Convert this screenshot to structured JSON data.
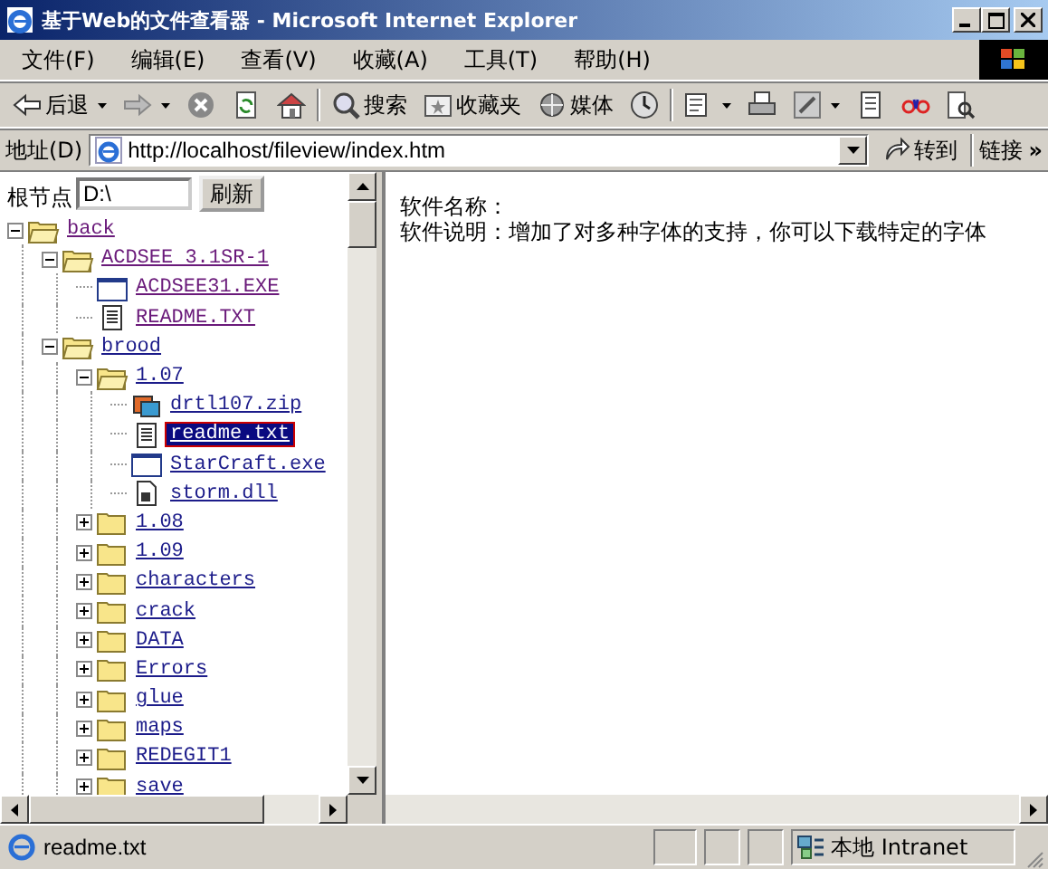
{
  "window": {
    "title": "基于Web的文件查看器 - Microsoft Internet Explorer"
  },
  "menu": [
    "文件(F)",
    "编辑(E)",
    "查看(V)",
    "收藏(A)",
    "工具(T)",
    "帮助(H)"
  ],
  "toolbar": [
    {
      "kind": "back",
      "label": "后退",
      "dropdown": true
    },
    {
      "kind": "forward",
      "dropdown": true
    },
    {
      "kind": "stop",
      "dropdown": false
    },
    {
      "kind": "refresh",
      "dropdown": false
    },
    {
      "kind": "home",
      "dropdown": false
    },
    {
      "kind": "separator"
    },
    {
      "kind": "search",
      "label": "搜索",
      "dropdown": false
    },
    {
      "kind": "favorites",
      "label": "收藏夹",
      "dropdown": false
    },
    {
      "kind": "media",
      "label": "媒体",
      "dropdown": false
    },
    {
      "kind": "history",
      "dropdown": false
    },
    {
      "kind": "separator"
    },
    {
      "kind": "mail",
      "dropdown": true
    },
    {
      "kind": "print",
      "dropdown": false
    },
    {
      "kind": "edit",
      "dropdown": true
    },
    {
      "kind": "discuss",
      "dropdown": false
    },
    {
      "kind": "messenger",
      "dropdown": false
    },
    {
      "kind": "research",
      "dropdown": false
    }
  ],
  "address": {
    "label": "地址(D)",
    "url": "http://localhost/fileview/index.htm",
    "go": "转到",
    "links": "链接",
    "more": "»"
  },
  "left_frame": {
    "root_label": "根节点",
    "root_value": "D:\\",
    "refresh": "刷新",
    "tree": [
      {
        "label": "back",
        "kind": "folder",
        "expanded": true,
        "selected": false,
        "visited": true,
        "children": [
          {
            "label": "ACDSEE 3.1SR-1",
            "kind": "folder",
            "expanded": true,
            "selected": false,
            "visited": true,
            "children": [
              {
                "label": "ACDSEE31.EXE",
                "kind": "exe",
                "selected": false,
                "visited": true
              },
              {
                "label": "README.TXT",
                "kind": "txt",
                "selected": false,
                "visited": true
              }
            ]
          },
          {
            "label": "brood",
            "kind": "folder",
            "expanded": true,
            "selected": false,
            "visited": false,
            "children": [
              {
                "label": "1.07",
                "kind": "folder",
                "expanded": true,
                "selected": false,
                "visited": false,
                "children": [
                  {
                    "label": "drtl107.zip",
                    "kind": "zip",
                    "selected": false,
                    "visited": false
                  },
                  {
                    "label": "readme.txt",
                    "kind": "txt",
                    "selected": true,
                    "visited": false
                  },
                  {
                    "label": "StarCraft.exe",
                    "kind": "exe",
                    "selected": false,
                    "visited": false
                  },
                  {
                    "label": "storm.dll",
                    "kind": "dll",
                    "selected": false,
                    "visited": false
                  }
                ]
              },
              {
                "label": "1.08",
                "kind": "folder",
                "expanded": false,
                "selected": false,
                "visited": false
              },
              {
                "label": "1.09",
                "kind": "folder",
                "expanded": false,
                "selected": false,
                "visited": false
              },
              {
                "label": "characters",
                "kind": "folder",
                "expanded": false,
                "selected": false,
                "visited": false
              },
              {
                "label": "crack",
                "kind": "folder",
                "expanded": false,
                "selected": false,
                "visited": false
              },
              {
                "label": "DATA",
                "kind": "folder",
                "expanded": false,
                "selected": false,
                "visited": false
              },
              {
                "label": "Errors",
                "kind": "folder",
                "expanded": false,
                "selected": false,
                "visited": false
              },
              {
                "label": "glue",
                "kind": "folder",
                "expanded": false,
                "selected": false,
                "visited": false
              },
              {
                "label": "maps",
                "kind": "folder",
                "expanded": false,
                "selected": false,
                "visited": false
              },
              {
                "label": "REDEGIT1",
                "kind": "folder",
                "expanded": false,
                "selected": false,
                "visited": false
              },
              {
                "label": "save",
                "kind": "folder",
                "expanded": false,
                "selected": false,
                "visited": false
              }
            ]
          }
        ]
      }
    ]
  },
  "right_frame": {
    "lines": [
      "软件名称：",
      "软件说明：增加了对多种字体的支持，你可以下载特定的字体"
    ]
  },
  "status_bar": {
    "text": "readme.txt",
    "zone": "本地 Intranet"
  }
}
